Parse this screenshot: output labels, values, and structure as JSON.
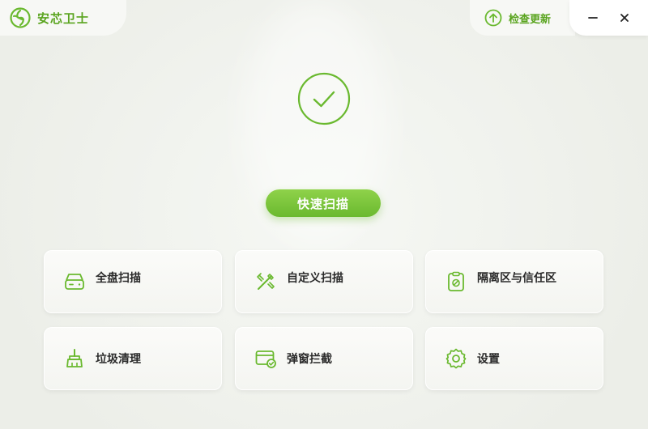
{
  "app": {
    "title": "安芯卫士"
  },
  "header": {
    "update_label": "检查更新"
  },
  "status": {
    "state": "ok"
  },
  "main": {
    "scan_button_label": "快速扫描"
  },
  "features": [
    {
      "label": "全盘扫描",
      "icon": "disk-icon"
    },
    {
      "label": "自定义扫描",
      "icon": "tools-icon"
    },
    {
      "label": "隔离区与信任区",
      "icon": "clipboard-block-icon"
    },
    {
      "label": "垃圾清理",
      "icon": "broom-icon"
    },
    {
      "label": "弹窗拦截",
      "icon": "popup-block-icon"
    },
    {
      "label": "设置",
      "icon": "gear-icon"
    }
  ],
  "colors": {
    "accent": "#6ab92f",
    "accent_light": "#8fd24a",
    "text": "#2a2a2a",
    "background": "#f1f3ee"
  }
}
